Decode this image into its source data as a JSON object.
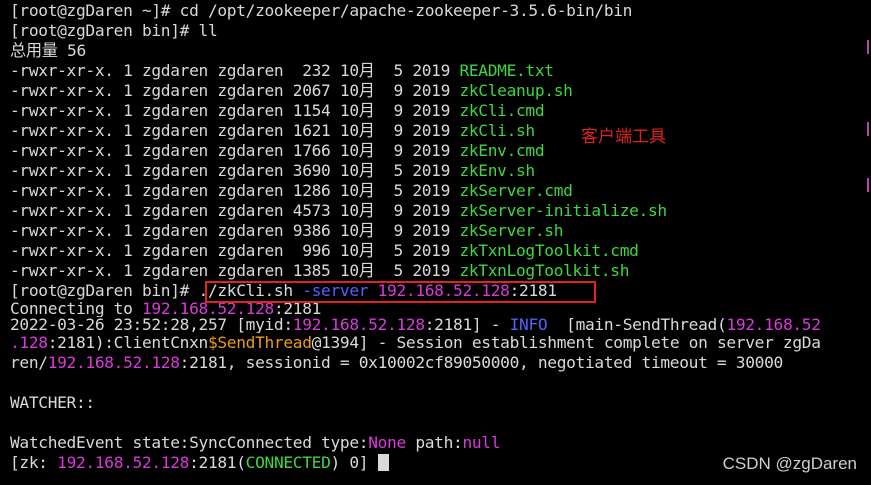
{
  "terminal": {
    "lines": [
      {
        "segments": [
          {
            "text": "[root@zgDaren ~]# cd /opt/zookeeper/apache-zookeeper-3.5.6-bin/bin",
            "color": "default"
          }
        ]
      },
      {
        "segments": [
          {
            "text": "[root@zgDaren bin]# ll",
            "color": "default"
          }
        ]
      },
      {
        "segments": [
          {
            "text": "总用量 56",
            "color": "default"
          }
        ]
      },
      {
        "segments": [
          {
            "text": "-rwxr-xr-x. 1 zgdaren zgdaren  232 10月  5 2019 ",
            "color": "default"
          },
          {
            "text": "README.txt",
            "color": "green"
          }
        ]
      },
      {
        "segments": [
          {
            "text": "-rwxr-xr-x. 1 zgdaren zgdaren 2067 10月  9 2019 ",
            "color": "default"
          },
          {
            "text": "zkCleanup.sh",
            "color": "green"
          }
        ]
      },
      {
        "segments": [
          {
            "text": "-rwxr-xr-x. 1 zgdaren zgdaren 1154 10月  9 2019 ",
            "color": "default"
          },
          {
            "text": "zkCli.cmd",
            "color": "green"
          }
        ]
      },
      {
        "segments": [
          {
            "text": "-rwxr-xr-x. 1 zgdaren zgdaren 1621 10月  9 2019 ",
            "color": "default"
          },
          {
            "text": "zkCli.sh",
            "color": "green"
          }
        ]
      },
      {
        "segments": [
          {
            "text": "-rwxr-xr-x. 1 zgdaren zgdaren 1766 10月  9 2019 ",
            "color": "default"
          },
          {
            "text": "zkEnv.cmd",
            "color": "green"
          }
        ]
      },
      {
        "segments": [
          {
            "text": "-rwxr-xr-x. 1 zgdaren zgdaren 3690 10月  5 2019 ",
            "color": "default"
          },
          {
            "text": "zkEnv.sh",
            "color": "green"
          }
        ]
      },
      {
        "segments": [
          {
            "text": "-rwxr-xr-x. 1 zgdaren zgdaren 1286 10月  5 2019 ",
            "color": "default"
          },
          {
            "text": "zkServer.cmd",
            "color": "green"
          }
        ]
      },
      {
        "segments": [
          {
            "text": "-rwxr-xr-x. 1 zgdaren zgdaren 4573 10月  9 2019 ",
            "color": "default"
          },
          {
            "text": "zkServer-initialize.sh",
            "color": "green"
          }
        ]
      },
      {
        "segments": [
          {
            "text": "-rwxr-xr-x. 1 zgdaren zgdaren 9386 10月  9 2019 ",
            "color": "default"
          },
          {
            "text": "zkServer.sh",
            "color": "green"
          }
        ]
      },
      {
        "segments": [
          {
            "text": "-rwxr-xr-x. 1 zgdaren zgdaren  996 10月  5 2019 ",
            "color": "default"
          },
          {
            "text": "zkTxnLogToolkit.cmd",
            "color": "green"
          }
        ]
      },
      {
        "segments": [
          {
            "text": "-rwxr-xr-x. 1 zgdaren zgdaren 1385 10月  5 2019 ",
            "color": "default"
          },
          {
            "text": "zkTxnLogToolkit.sh",
            "color": "green"
          }
        ]
      },
      {
        "segments": [
          {
            "text": "[root@zgDaren bin]# ./zkCli.sh ",
            "color": "default"
          },
          {
            "text": "-server",
            "color": "blue"
          },
          {
            "text": " ",
            "color": "default"
          },
          {
            "text": "192.168.52.128",
            "color": "magenta"
          },
          {
            "text": ":2181",
            "color": "default"
          }
        ]
      },
      {
        "short": true,
        "segments": [
          {
            "text": "Connecting to ",
            "color": "default"
          },
          {
            "text": "192.168.52.128",
            "color": "magenta"
          },
          {
            "text": ":2181",
            "color": "default"
          }
        ]
      },
      {
        "short": true,
        "segments": [
          {
            "text": "2022-03-26 23:52:28,257 [myid:",
            "color": "default"
          },
          {
            "text": "192.168.52.128",
            "color": "magenta"
          },
          {
            "text": ":2181] - ",
            "color": "default"
          },
          {
            "text": "INFO",
            "color": "blue"
          },
          {
            "text": "  [main-SendThread(",
            "color": "default"
          },
          {
            "text": "192.168.52",
            "color": "magenta"
          }
        ]
      },
      {
        "segments": [
          {
            "text": ".128",
            "color": "magenta"
          },
          {
            "text": ":2181):ClientCnxn",
            "color": "default"
          },
          {
            "text": "$SendThread",
            "color": "orange"
          },
          {
            "text": "@1394] - Session establishment complete on server zgDa",
            "color": "default"
          }
        ]
      },
      {
        "segments": [
          {
            "text": "ren/",
            "color": "default"
          },
          {
            "text": "192.168.52.128",
            "color": "magenta"
          },
          {
            "text": ":2181, sessionid = 0x10002cf89050000, negotiated timeout = 30000",
            "color": "default"
          }
        ]
      },
      {
        "segments": [
          {
            "text": "",
            "color": "default"
          }
        ]
      },
      {
        "segments": [
          {
            "text": "WATCHER::",
            "color": "default"
          }
        ]
      },
      {
        "segments": [
          {
            "text": "",
            "color": "default"
          }
        ]
      },
      {
        "segments": [
          {
            "text": "WatchedEvent state:SyncConnected type:",
            "color": "default"
          },
          {
            "text": "None",
            "color": "magenta"
          },
          {
            "text": " path:",
            "color": "default"
          },
          {
            "text": "null",
            "color": "magenta"
          }
        ]
      },
      {
        "cursor": true,
        "segments": [
          {
            "text": "[zk: ",
            "color": "default"
          },
          {
            "text": "192.168.52.128",
            "color": "magenta"
          },
          {
            "text": ":2181(",
            "color": "default"
          },
          {
            "text": "CONNECTED",
            "color": "green"
          },
          {
            "text": ") 0] ",
            "color": "default"
          }
        ]
      }
    ]
  },
  "annotation": {
    "label": "客户端工具",
    "color": "#e02222"
  },
  "watermark": "CSDN @zgDaren",
  "colors": {
    "background": "#000000",
    "default_text": "#d9d9d9",
    "green": "#3fd63f",
    "magenta": "#d93ad9",
    "orange": "#ee9b1b",
    "blue": "#5560ff"
  }
}
